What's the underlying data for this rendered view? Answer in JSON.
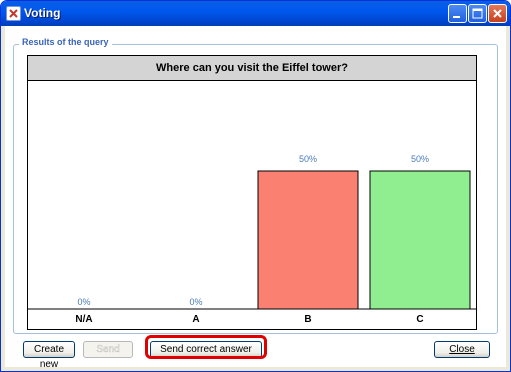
{
  "window": {
    "title": "Voting",
    "icon": "voting-app-icon",
    "controls": {
      "minimize": "minimize-icon",
      "maximize": "maximize-icon",
      "close": "close-icon"
    }
  },
  "group": {
    "label": "Results of the query"
  },
  "chart_data": {
    "type": "bar",
    "title": "Where can you visit the Eiffel tower?",
    "categories": [
      "N/A",
      "A",
      "B",
      "C"
    ],
    "values": [
      0,
      0,
      50,
      50
    ],
    "data_labels": [
      "0%",
      "0%",
      "50%",
      "50%"
    ],
    "ylim": [
      0,
      100
    ],
    "unit": "%",
    "colors": [
      "#ffffff",
      "#ffffff",
      "#fa8072",
      "#90ee90"
    ],
    "label_color": "#4a7ab8",
    "grid": false
  },
  "buttons": {
    "create_new": "Create new",
    "send": "Send",
    "send_correct": "Send correct answer",
    "close": "Close"
  },
  "highlight_color": "#e00000"
}
